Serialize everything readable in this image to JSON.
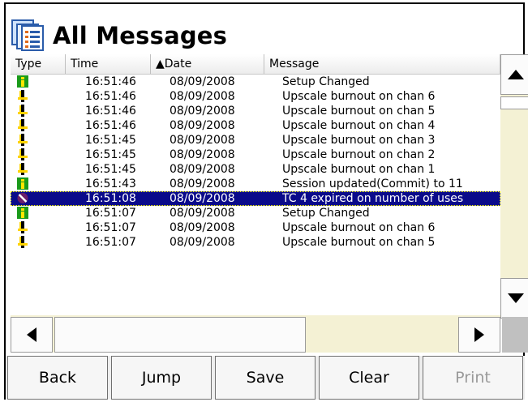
{
  "window": {
    "title": "All Messages"
  },
  "columns": [
    {
      "label": "Type"
    },
    {
      "label": "Time"
    },
    {
      "label": "▲Date"
    },
    {
      "label": "Message"
    }
  ],
  "rows": [
    {
      "type": "info",
      "time": "16:51:46",
      "date": "08/09/2008",
      "message": "Setup Changed"
    },
    {
      "type": "warning",
      "time": "16:51:46",
      "date": "08/09/2008",
      "message": "Upscale burnout on chan 6"
    },
    {
      "type": "warning",
      "time": "16:51:46",
      "date": "08/09/2008",
      "message": "Upscale burnout on chan 5"
    },
    {
      "type": "warning",
      "time": "16:51:46",
      "date": "08/09/2008",
      "message": "Upscale burnout on chan 4"
    },
    {
      "type": "warning",
      "time": "16:51:45",
      "date": "08/09/2008",
      "message": "Upscale burnout on chan 3"
    },
    {
      "type": "warning",
      "time": "16:51:45",
      "date": "08/09/2008",
      "message": "Upscale burnout on chan 2"
    },
    {
      "type": "warning",
      "time": "16:51:45",
      "date": "08/09/2008",
      "message": "Upscale burnout on chan 1"
    },
    {
      "type": "info",
      "time": "16:51:43",
      "date": "08/09/2008",
      "message": "Session updated(Commit) to 11"
    },
    {
      "type": "error",
      "time": "16:51:08",
      "date": "08/09/2008",
      "message": "TC 4 expired on number of uses",
      "selected": true
    },
    {
      "type": "info",
      "time": "16:51:07",
      "date": "08/09/2008",
      "message": "Setup Changed"
    },
    {
      "type": "warning",
      "time": "16:51:07",
      "date": "08/09/2008",
      "message": "Upscale burnout on chan 6"
    },
    {
      "type": "warning",
      "time": "16:51:07",
      "date": "08/09/2008",
      "message": "Upscale burnout on chan 5"
    }
  ],
  "buttons": {
    "back": "Back",
    "jump": "Jump",
    "save": "Save",
    "clear": "Clear",
    "print": "Print"
  },
  "icons": {
    "app": "message-list-icon",
    "info": "info-icon",
    "warning": "warning-icon",
    "error": "error-icon"
  },
  "colors": {
    "selection": "#0a0a8a",
    "info_green": "#1a9a1a",
    "warning_yellow": "#ffd400",
    "error_purple": "#6b1f6b",
    "panel_bg": "#f4f1d4"
  }
}
